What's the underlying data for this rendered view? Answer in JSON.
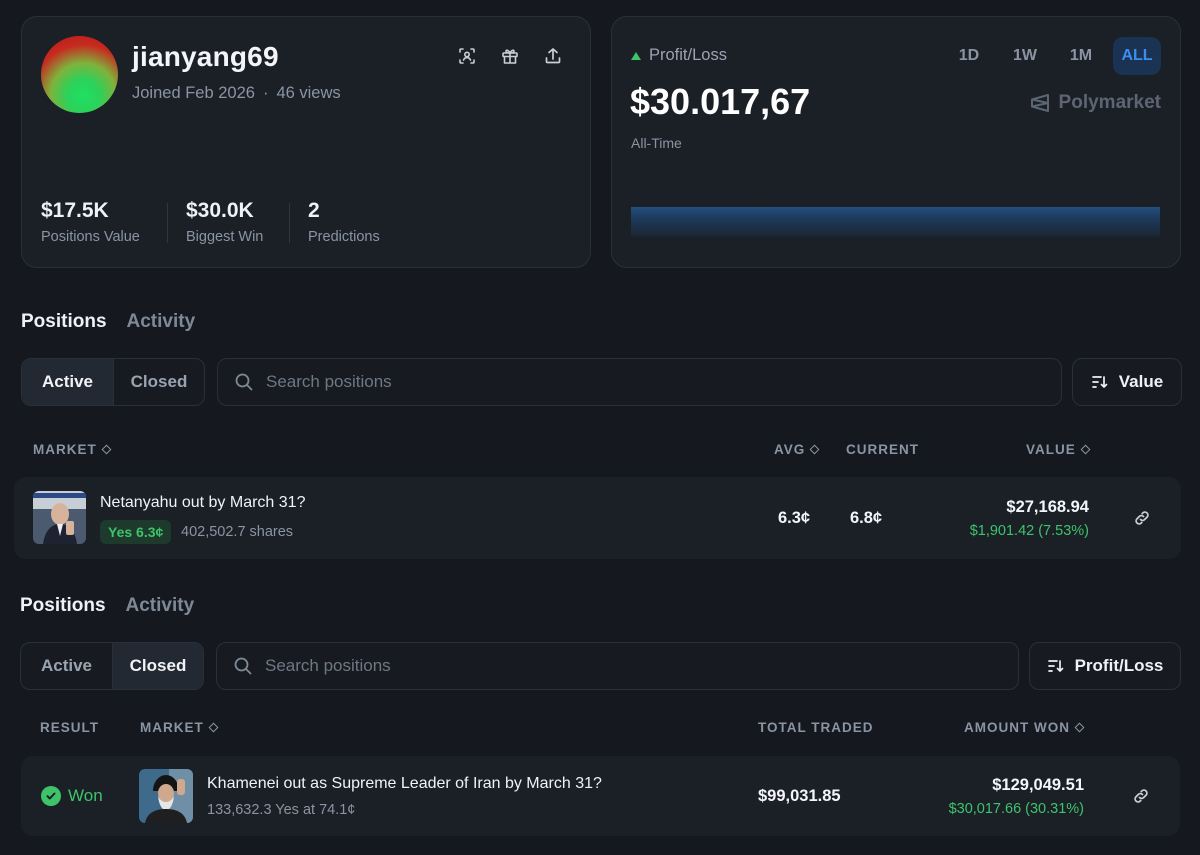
{
  "profile": {
    "username": "jianyang69",
    "joined": "Joined Feb 2026",
    "separator": "·",
    "views": "46 views",
    "icons": [
      "scan-icon",
      "gift-icon",
      "share-icon"
    ],
    "stats": [
      {
        "value": "$17.5K",
        "label": "Positions Value"
      },
      {
        "value": "$30.0K",
        "label": "Biggest Win"
      },
      {
        "value": "2",
        "label": "Predictions"
      }
    ]
  },
  "pnl": {
    "title": "Profit/Loss",
    "value": "$30.017,67",
    "sub": "All-Time",
    "ranges": [
      "1D",
      "1W",
      "1M",
      "ALL"
    ],
    "active_range": "ALL",
    "brand": "Polymarket",
    "colors": {
      "up": "#3ec36a",
      "active_range_bg": "#1b3352",
      "active_range_fg": "#3b8ef0"
    }
  },
  "active_view": {
    "tabs": [
      "Positions",
      "Activity"
    ],
    "filters": [
      "Active",
      "Closed"
    ],
    "search_placeholder": "Search positions",
    "sort_label": "Value",
    "headers": {
      "market": "MARKET",
      "avg": "AVG",
      "current": "CURRENT",
      "value": "VALUE"
    },
    "row": {
      "title": "Netanyahu out by March 31?",
      "outcome": "Yes 6.3¢",
      "shares": "402,502.7 shares",
      "avg": "6.3¢",
      "current": "6.8¢",
      "value": "$27,168.94",
      "change": "$1,901.42 (7.53%)"
    }
  },
  "closed_view": {
    "tabs": [
      "Positions",
      "Activity"
    ],
    "filters": [
      "Active",
      "Closed"
    ],
    "search_placeholder": "Search positions",
    "sort_label": "Profit/Loss",
    "headers": {
      "result": "RESULT",
      "market": "MARKET",
      "total_traded": "TOTAL TRADED",
      "amount_won": "AMOUNT WON"
    },
    "row": {
      "result": "Won",
      "title": "Khamenei out as Supreme Leader of Iran by March 31?",
      "detail": "133,632.3 Yes at 74.1¢",
      "total_traded": "$99,031.85",
      "amount_won": "$129,049.51",
      "profit": "$30,017.66 (30.31%)"
    }
  }
}
